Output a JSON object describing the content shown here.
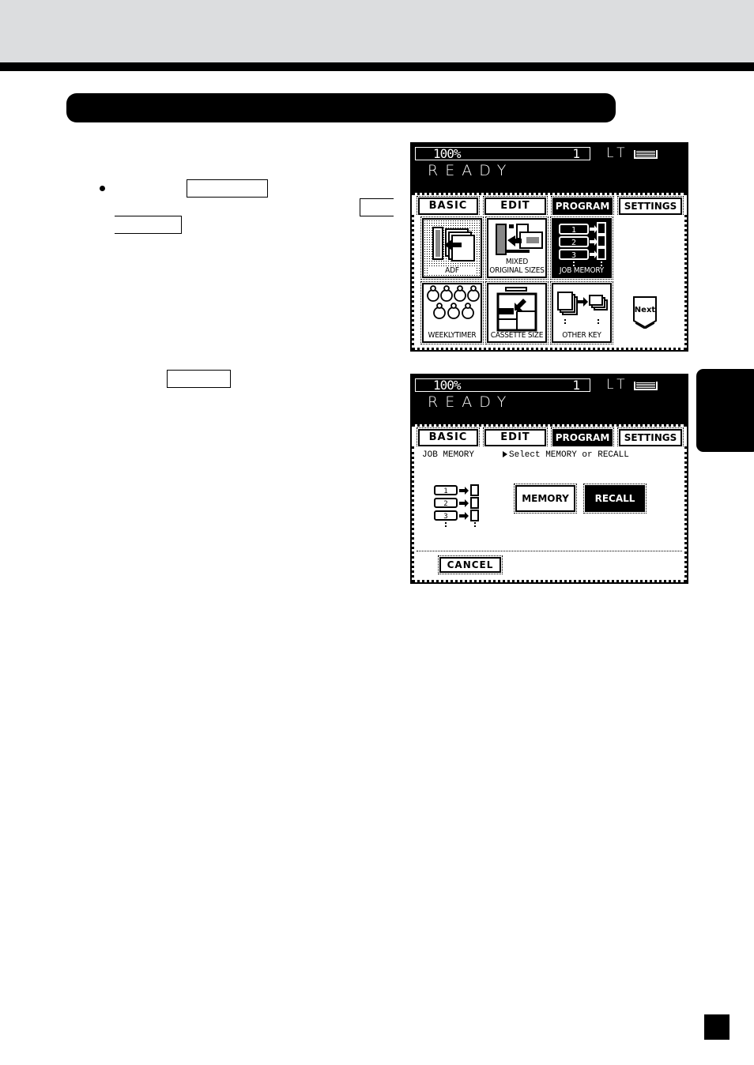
{
  "page": {
    "section_title": "",
    "inline_keys": [
      "",
      "",
      "",
      ""
    ],
    "side_tab_label": "",
    "page_number": ""
  },
  "screens": [
    {
      "status": {
        "zoom": "100%",
        "count": "1",
        "paper": "LT",
        "message": "READY"
      },
      "tabs": [
        {
          "label": "BASIC",
          "active": false
        },
        {
          "label": "EDIT",
          "active": false
        },
        {
          "label": "PROGRAM",
          "active": true
        },
        {
          "label": "SETTINGS",
          "active": false
        }
      ],
      "functions": [
        {
          "label": "ADF",
          "icon": "adf-icon",
          "state": "selected-dotted"
        },
        {
          "label_line1": "MIXED",
          "label_line2": "ORIGINAL SIZES",
          "icon": "mixed-original-sizes-icon",
          "state": "normal"
        },
        {
          "label": "JOB MEMORY",
          "icon": "job-memory-icon",
          "state": "highlighted"
        },
        {
          "label": "WEEKLYTIMER",
          "icon": "weekly-timer-icon",
          "state": "normal"
        },
        {
          "label": "CASSETTE SIZE",
          "icon": "cassette-size-icon",
          "state": "normal"
        },
        {
          "label": "OTHER KEY",
          "icon": "other-key-icon",
          "state": "normal"
        }
      ],
      "next_label": "Next"
    },
    {
      "status": {
        "zoom": "100%",
        "count": "1",
        "paper": "LT",
        "message": "READY"
      },
      "tabs": [
        {
          "label": "BASIC",
          "active": false
        },
        {
          "label": "EDIT",
          "active": false
        },
        {
          "label": "PROGRAM",
          "active": true
        },
        {
          "label": "SETTINGS",
          "active": false
        }
      ],
      "header": "JOB MEMORY",
      "prompt": "Select MEMORY or RECALL",
      "memory_label": "MEMORY",
      "recall_label": "RECALL",
      "cancel_label": "CANCEL",
      "slot_numbers": [
        "1",
        "2",
        "3"
      ]
    }
  ]
}
